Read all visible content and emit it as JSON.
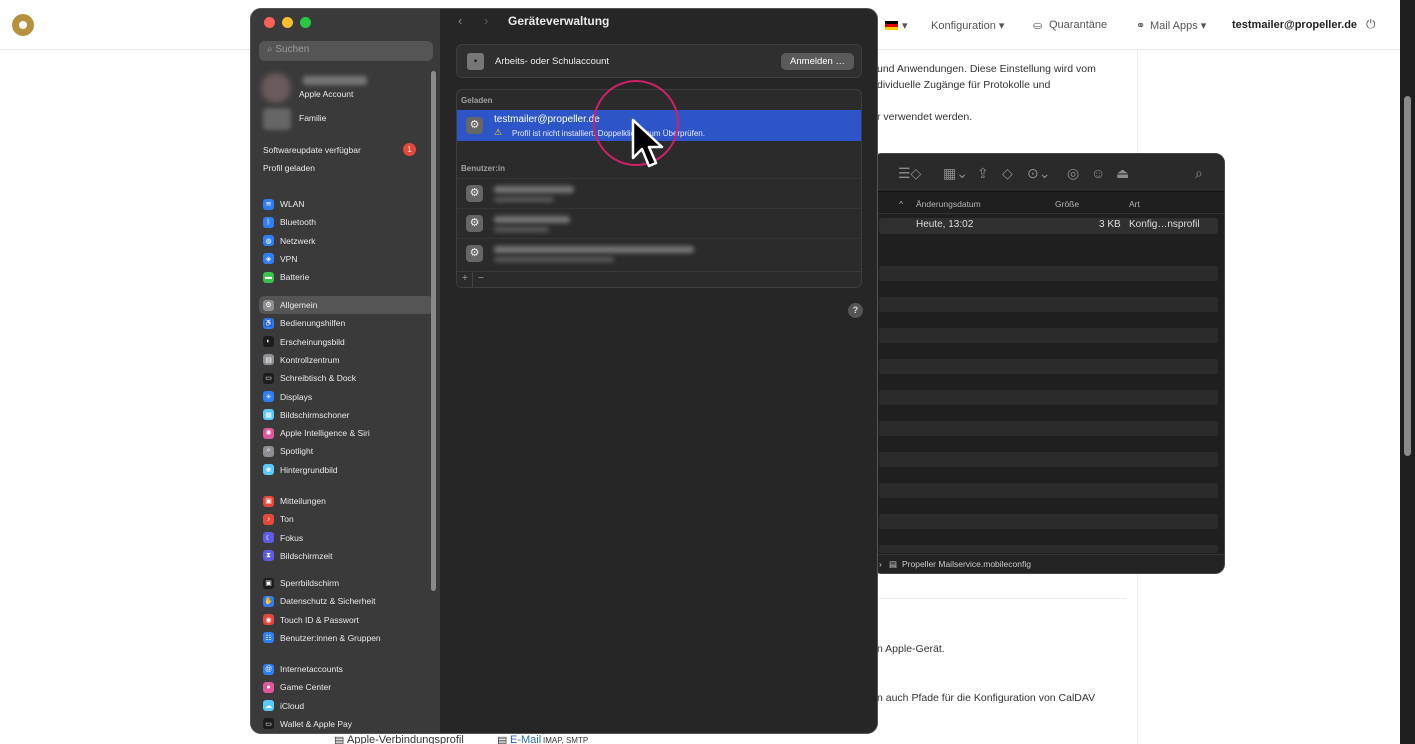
{
  "web": {
    "nav": {
      "konfiguration": "Konfiguration ▾",
      "quarantaene": "Quarantäne",
      "mail_apps": "Mail Apps ▾",
      "user": "testmailer@propeller.de",
      "flag_caret": "▾"
    },
    "body_lines": [
      "und Anwendungen. Diese Einstellung wird vom",
      "dividuelle Zugänge für Protokolle und",
      "r verwendet werden.",
      "n Apple-Gerät.",
      "n auch Pfade für die Konfiguration von CalDAV"
    ],
    "bottom_links": {
      "item1": "Apple-Verbindungsprofil",
      "item2": "E-Mail",
      "item2_suffix": "IMAP, SMTP"
    }
  },
  "finder": {
    "columns": {
      "date": "Änderungsdatum",
      "size": "Größe",
      "kind": "Art"
    },
    "row": {
      "date": "Heute, 13:02",
      "size": "3 KB",
      "kind": "Konfig…nsprofil"
    },
    "path": "Propeller Mailservice.mobileconfig"
  },
  "settings": {
    "search_placeholder": "Suchen",
    "account": {
      "label": "Apple Account",
      "family": "Familie"
    },
    "update_label": "Softwareupdate verfügbar",
    "update_badge": "1",
    "profile_loaded": "Profil geladen",
    "groups": [
      [
        {
          "label": "WLAN",
          "color": "#2f7ef6",
          "glyph": "≋"
        },
        {
          "label": "Bluetooth",
          "color": "#2f7ef6",
          "glyph": "ᛒ"
        },
        {
          "label": "Netzwerk",
          "color": "#2f7ef6",
          "glyph": "◍"
        },
        {
          "label": "VPN",
          "color": "#2f7ef6",
          "glyph": "◈"
        },
        {
          "label": "Batterie",
          "color": "#3cbf4c",
          "glyph": "▬"
        }
      ],
      [
        {
          "label": "Allgemein",
          "color": "#8e8e93",
          "glyph": "⚙",
          "selected": true
        },
        {
          "label": "Bedienungshilfen",
          "color": "#2f7ef6",
          "glyph": "♿"
        },
        {
          "label": "Erscheinungsbild",
          "color": "#1c1c1c",
          "glyph": "◐"
        },
        {
          "label": "Kontrollzentrum",
          "color": "#8e8e93",
          "glyph": "▤"
        },
        {
          "label": "Schreibtisch & Dock",
          "color": "#1c1c1c",
          "glyph": "▭"
        },
        {
          "label": "Displays",
          "color": "#2f7ef6",
          "glyph": "☀"
        },
        {
          "label": "Bildschirmschoner",
          "color": "#5ac8fa",
          "glyph": "▦"
        },
        {
          "label": "Apple Intelligence & Siri",
          "color": "#e0569b",
          "glyph": "✺"
        },
        {
          "label": "Spotlight",
          "color": "#8e8e93",
          "glyph": "⌕"
        },
        {
          "label": "Hintergrundbild",
          "color": "#5ac8fa",
          "glyph": "❀"
        }
      ],
      [
        {
          "label": "Mitteilungen",
          "color": "#e5483a",
          "glyph": "▣"
        },
        {
          "label": "Ton",
          "color": "#e5483a",
          "glyph": "♪"
        },
        {
          "label": "Fokus",
          "color": "#5e5ce6",
          "glyph": "☾"
        },
        {
          "label": "Bildschirmzeit",
          "color": "#5e5ce6",
          "glyph": "⧗"
        }
      ],
      [
        {
          "label": "Sperrbildschirm",
          "color": "#1c1c1c",
          "glyph": "▣"
        },
        {
          "label": "Datenschutz & Sicherheit",
          "color": "#2f7ef6",
          "glyph": "✋"
        },
        {
          "label": "Touch ID & Passwort",
          "color": "#e5483a",
          "glyph": "◉"
        },
        {
          "label": "Benutzer:innen & Gruppen",
          "color": "#2f7ef6",
          "glyph": "☷"
        }
      ],
      [
        {
          "label": "Internetaccounts",
          "color": "#2f7ef6",
          "glyph": "@"
        },
        {
          "label": "Game Center",
          "color": "#e0569b",
          "glyph": "●"
        },
        {
          "label": "iCloud",
          "color": "#5ac8fa",
          "glyph": "☁"
        },
        {
          "label": "Wallet & Apple Pay",
          "color": "#1c1c1c",
          "glyph": "▭"
        }
      ]
    ],
    "main": {
      "title": "Geräteverwaltung",
      "work_account": "Arbeits- oder Schulaccount",
      "sign_in": "Anmelden …",
      "section_loaded": "Geladen",
      "profile_name": "testmailer@propeller.de",
      "profile_status": "Profil ist nicht installiert. Doppelklicke zum Überprüfen.",
      "section_user": "Benutzer:in",
      "plus": "+",
      "minus": "−",
      "help": "?"
    }
  }
}
